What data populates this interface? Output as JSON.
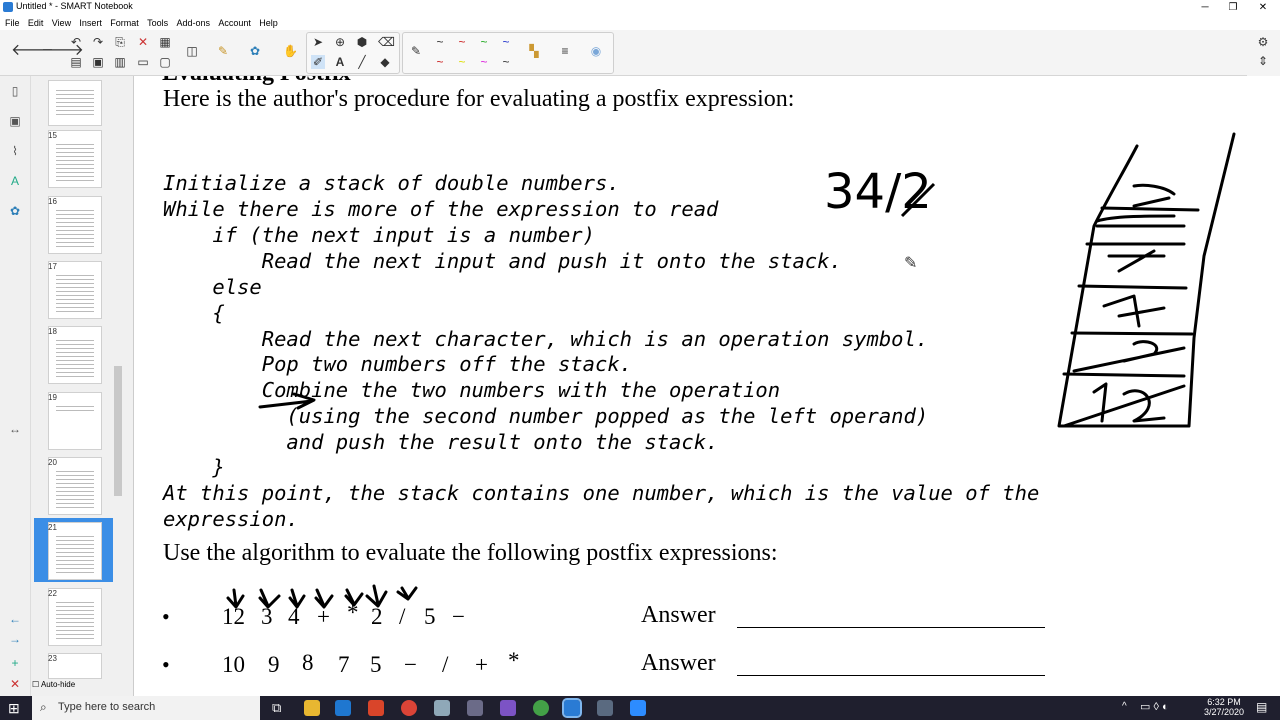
{
  "window": {
    "title": "Untitled * - SMART Notebook",
    "minimize": "─",
    "maximize": "❐",
    "close": "✕"
  },
  "menu": [
    "File",
    "Edit",
    "View",
    "Insert",
    "Format",
    "Tools",
    "Add-ons",
    "Account",
    "Help"
  ],
  "toolbar": {
    "left_icons": [
      "back-arrow-icon",
      "forward-arrow-icon",
      "undo-icon",
      "redo-icon",
      "add-page-icon",
      "delete-icon",
      "table-icon",
      "screen-shade-icon",
      "gallery-icon",
      "smart-icon",
      "hand-icon"
    ],
    "right_icons": [
      "select-icon",
      "magic-pen-icon",
      "fill-icon",
      "eraser-icon",
      "text-icon",
      "line-icon",
      "shapes-icon",
      "pen-icon"
    ]
  },
  "sorter": {
    "thumbnails": [
      {
        "num": ""
      },
      {
        "num": "15"
      },
      {
        "num": "16"
      },
      {
        "num": "17"
      },
      {
        "num": "18"
      },
      {
        "num": "19"
      },
      {
        "num": "20"
      },
      {
        "num": "21"
      },
      {
        "num": "22"
      },
      {
        "num": "23"
      }
    ],
    "auto_hide": "Auto-hide"
  },
  "slide": {
    "heading_cut": "Evaluating Postfix",
    "intro": "Here is the author's procedure for evaluating a postfix expression:",
    "code": [
      "Initialize a stack of double numbers.",
      "While there is more of the expression to read",
      "    if (the next input is a number)",
      "        Read the next input and push it onto the stack.",
      "    else",
      "    {",
      "        Read the next character, which is an operation symbol.",
      "        Pop two numbers off the stack.",
      "        Combine the two numbers with the operation",
      "          (using the second number popped as the left operand)",
      "          and push the result onto the stack.",
      "    }",
      "At this point, the stack contains one number, which is the value of the",
      "expression."
    ],
    "prompt": "Use the algorithm to evaluate the following postfix expressions:",
    "expr1": {
      "bullet": "•",
      "tokens": [
        "12",
        "3",
        "4",
        "+",
        "*",
        "2",
        "/",
        "5",
        "−"
      ],
      "answer_label": "Answer"
    },
    "expr2": {
      "bullet": "•",
      "tokens": [
        "10",
        "9",
        "8",
        "7",
        "5",
        "−",
        "/",
        "+",
        "*"
      ],
      "answer_label": "Answer"
    },
    "handwriting": {
      "expr": "34/2",
      "stack": [
        "2",
        "34",
        "7",
        "4",
        "3",
        "12"
      ]
    }
  },
  "taskbar": {
    "search_placeholder": "Type here to search",
    "time": "6:32 PM",
    "date": "3/27/2020"
  }
}
